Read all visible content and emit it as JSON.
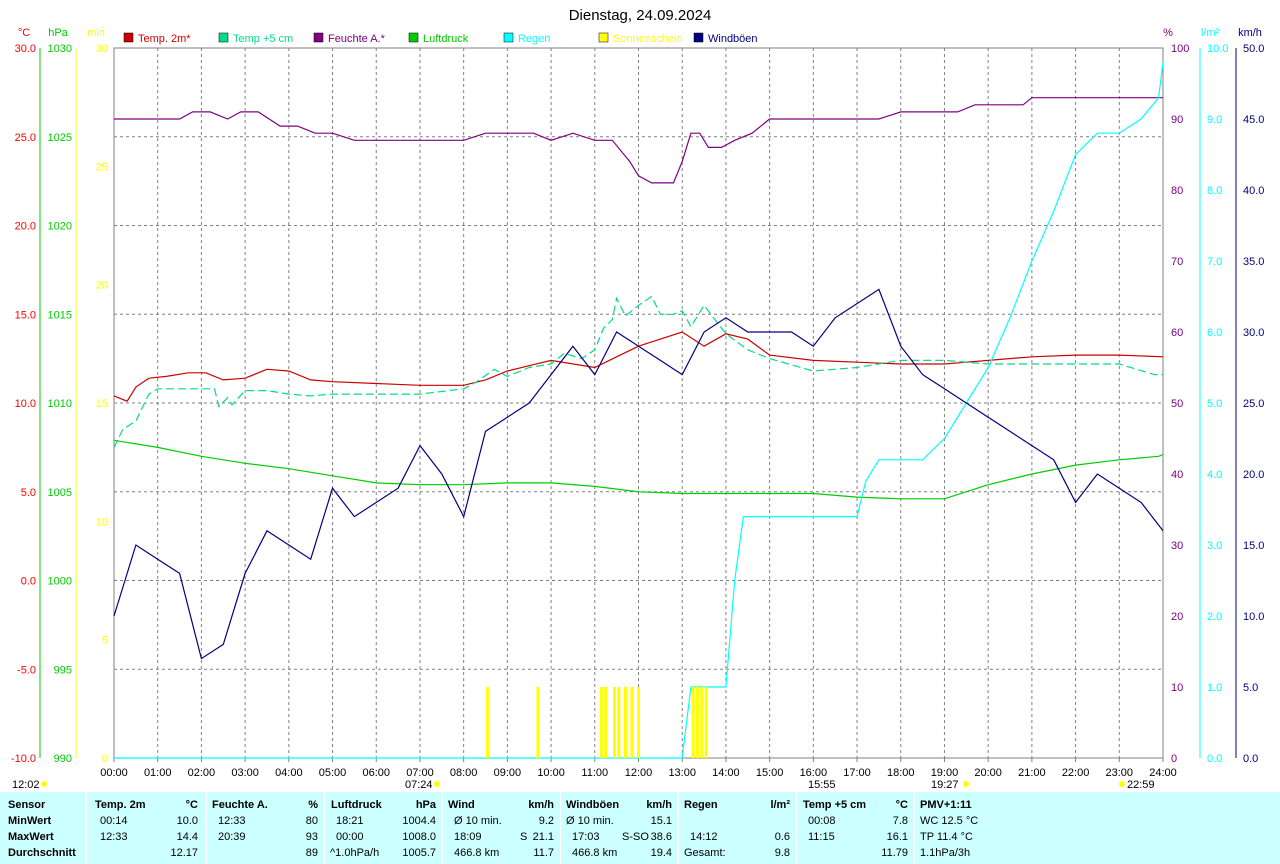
{
  "title": "Dienstag, 24.09.2024",
  "chart_data": {
    "type": "line",
    "x_label_times": [
      "00:00",
      "01:00",
      "02:00",
      "03:00",
      "04:00",
      "05:00",
      "06:00",
      "07:00",
      "08:00",
      "09:00",
      "10:00",
      "11:00",
      "12:00",
      "13:00",
      "14:00",
      "15:00",
      "16:00",
      "17:00",
      "18:00",
      "19:00",
      "20:00",
      "21:00",
      "22:00",
      "23:00",
      "24:00"
    ],
    "x_range_hours": [
      0,
      24
    ],
    "axes": {
      "temp_c": {
        "unit": "°C",
        "range": [
          -10,
          30
        ],
        "ticks": [
          "30.0",
          "25.0",
          "20.0",
          "15.0",
          "10.0",
          "5.0",
          "0.0",
          "-5.0",
          "-10.0"
        ],
        "color": "#ff0000"
      },
      "press_hpa": {
        "unit": "hPa",
        "range": [
          990,
          1030
        ],
        "ticks": [
          "1030",
          "1025",
          "1020",
          "1015",
          "1010",
          "1005",
          "1000",
          "995",
          "990"
        ],
        "color": "#00cc00"
      },
      "sun_min": {
        "unit": "min",
        "range": [
          0,
          30
        ],
        "ticks": [
          "30",
          "25",
          "20",
          "15",
          "10",
          "5",
          "0"
        ],
        "color": "#ffff00"
      },
      "hum_pct": {
        "unit": "%",
        "range": [
          0,
          100
        ],
        "ticks": [
          "100",
          "90",
          "80",
          "70",
          "60",
          "50",
          "40",
          "30",
          "20",
          "10",
          "0"
        ],
        "color": "#800080"
      },
      "rain_lm2": {
        "unit": "l/m²",
        "range": [
          0,
          10
        ],
        "ticks": [
          "10.0",
          "9.0",
          "8.0",
          "7.0",
          "6.0",
          "5.0",
          "4.0",
          "3.0",
          "2.0",
          "1.0",
          "0.0"
        ],
        "color": "#00ffff"
      },
      "wind_kmh": {
        "unit": "km/h",
        "range": [
          0,
          50
        ],
        "ticks": [
          "50.0",
          "45.0",
          "40.0",
          "35.0",
          "30.0",
          "25.0",
          "20.0",
          "15.0",
          "10.0",
          "5.0",
          "0.0"
        ],
        "color": "#000080"
      }
    },
    "grid": true,
    "legend_position": "top",
    "series": [
      {
        "name": "Temp. 2m*",
        "color": "#cc0000",
        "axis": "temp_c",
        "x": [
          0,
          0.3,
          0.5,
          0.8,
          1.2,
          1.7,
          2.1,
          2.5,
          3.0,
          3.5,
          4.0,
          4.5,
          5.0,
          6.0,
          7.0,
          8.0,
          8.5,
          9.0,
          9.5,
          10.0,
          11.0,
          11.5,
          12.0,
          12.5,
          13.0,
          13.5,
          14.0,
          14.5,
          15.0,
          16.0,
          17.0,
          18.0,
          19.0,
          19.5,
          20.0,
          21.0,
          22.0,
          23.0,
          24.0
        ],
        "y": [
          10.4,
          10.1,
          10.9,
          11.4,
          11.5,
          11.7,
          11.7,
          11.3,
          11.4,
          11.9,
          11.8,
          11.3,
          11.2,
          11.1,
          11.0,
          11.0,
          11.3,
          11.8,
          12.1,
          12.4,
          12.0,
          12.6,
          13.2,
          13.6,
          14.0,
          13.2,
          13.9,
          13.6,
          12.7,
          12.4,
          12.3,
          12.2,
          12.2,
          12.3,
          12.4,
          12.6,
          12.7,
          12.7,
          12.6
        ]
      },
      {
        "name": "Temp +5 cm",
        "color": "#00dd88",
        "axis": "temp_c",
        "dashed": true,
        "x": [
          0,
          0.2,
          0.5,
          0.8,
          1.0,
          2.3,
          2.4,
          2.6,
          2.7,
          3.0,
          3.5,
          4.0,
          4.5,
          5.0,
          6.0,
          7.0,
          8.0,
          8.3,
          8.7,
          9.0,
          9.5,
          10.0,
          10.3,
          10.7,
          11.0,
          11.2,
          11.4,
          11.5,
          11.7,
          12.0,
          12.3,
          12.5,
          12.8,
          13.0,
          13.2,
          13.5,
          14.0,
          14.5,
          15.0,
          16.0,
          17.0,
          18.0,
          19.0,
          20.0,
          21.0,
          22.0,
          23.0,
          23.8,
          24.0
        ],
        "y": [
          7.5,
          8.5,
          9.0,
          10.5,
          10.8,
          10.8,
          9.8,
          10.3,
          9.9,
          10.7,
          10.7,
          10.5,
          10.4,
          10.5,
          10.5,
          10.5,
          10.8,
          11.2,
          11.9,
          11.5,
          12.0,
          12.2,
          12.8,
          12.5,
          13.0,
          14.2,
          14.7,
          15.9,
          14.9,
          15.5,
          16.0,
          15.0,
          15.0,
          15.2,
          14.3,
          15.5,
          13.9,
          13.0,
          12.5,
          11.8,
          12.0,
          12.4,
          12.4,
          12.2,
          12.2,
          12.2,
          12.2,
          11.6,
          11.6
        ]
      },
      {
        "name": "Feuchte A.*",
        "color": "#800080",
        "axis": "hum_pct",
        "x": [
          0,
          0.5,
          1.0,
          1.5,
          1.8,
          2.2,
          2.6,
          2.9,
          3.3,
          3.8,
          4.2,
          4.6,
          5.0,
          5.5,
          6.0,
          7.0,
          8.0,
          8.5,
          9.0,
          9.6,
          10.0,
          10.5,
          11.0,
          11.4,
          11.8,
          12.0,
          12.3,
          12.6,
          12.8,
          13.0,
          13.2,
          13.4,
          13.6,
          13.9,
          14.2,
          14.6,
          15.0,
          16.0,
          17.0,
          17.5,
          18.0,
          18.5,
          19.0,
          19.3,
          19.7,
          20.0,
          20.4,
          20.8,
          21.0,
          21.5,
          22.0,
          22.5,
          23.0,
          23.5,
          24.0
        ],
        "y": [
          90,
          90,
          90,
          90,
          91,
          91,
          90,
          91,
          91,
          89,
          89,
          88,
          88,
          87,
          87,
          87,
          87,
          88,
          88,
          88,
          87,
          88,
          87,
          87,
          84,
          82,
          81,
          81,
          81,
          84,
          88,
          88,
          86,
          86,
          87,
          88,
          90,
          90,
          90,
          90,
          91,
          91,
          91,
          91,
          92,
          92,
          92,
          92,
          93,
          93,
          93,
          93,
          93,
          93,
          93
        ]
      },
      {
        "name": "Luftdruck",
        "color": "#00cc00",
        "axis": "press_hpa",
        "x": [
          0,
          1,
          2,
          3,
          4,
          5,
          6,
          7,
          8,
          9,
          10,
          11,
          12,
          13,
          14,
          15,
          16,
          17,
          18,
          19,
          20,
          21,
          22,
          23,
          23.9,
          24
        ],
        "y": [
          1007.9,
          1007.5,
          1007.0,
          1006.6,
          1006.3,
          1005.9,
          1005.5,
          1005.4,
          1005.4,
          1005.5,
          1005.5,
          1005.3,
          1005.0,
          1004.9,
          1004.9,
          1004.9,
          1004.9,
          1004.7,
          1004.6,
          1004.6,
          1005.4,
          1006.0,
          1006.5,
          1006.8,
          1007.0,
          1007.1
        ]
      },
      {
        "name": "Regen",
        "color": "#00ffff",
        "axis": "rain_lm2",
        "x": [
          0,
          13.0,
          13.2,
          13.4,
          14.0,
          14.2,
          14.4,
          14.6,
          16.0,
          16.5,
          17.0,
          17.2,
          17.5,
          17.8,
          18.0,
          18.5,
          19.0,
          19.5,
          20.0,
          20.5,
          21.0,
          21.5,
          22.0,
          22.5,
          23.0,
          23.5,
          23.9,
          24
        ],
        "y": [
          0,
          0,
          1.0,
          1.0,
          1.0,
          2.5,
          3.4,
          3.4,
          3.4,
          3.4,
          3.4,
          3.9,
          4.2,
          4.2,
          4.2,
          4.2,
          4.5,
          5.0,
          5.5,
          6.2,
          7.0,
          7.7,
          8.5,
          8.8,
          8.8,
          9.0,
          9.3,
          9.8
        ]
      },
      {
        "name": "Sonnenschein",
        "color": "#ffff00",
        "axis": "sun_min",
        "x": [
          8.55,
          9.7,
          11.15,
          11.25,
          11.45,
          11.55,
          11.7,
          11.85,
          12.0,
          13.25,
          13.35,
          13.45,
          13.55
        ],
        "y": [
          3,
          3,
          3,
          3,
          3,
          3,
          3,
          3,
          3,
          3,
          3,
          3,
          3
        ]
      },
      {
        "name": "Windböen",
        "color": "#000080",
        "axis": "wind_kmh",
        "x": [
          0,
          0.5,
          1.0,
          1.5,
          2.0,
          2.5,
          3.0,
          3.5,
          4.0,
          4.5,
          5.0,
          5.5,
          6.0,
          6.5,
          7.0,
          7.5,
          8.0,
          8.5,
          9.0,
          9.5,
          10.0,
          10.5,
          11.0,
          11.5,
          12.0,
          12.5,
          13.0,
          13.5,
          14.0,
          14.5,
          15.0,
          15.5,
          16.0,
          16.5,
          17.0,
          17.5,
          18.0,
          18.5,
          19.0,
          19.5,
          20.0,
          20.5,
          21.0,
          21.5,
          22.0,
          22.5,
          23.0,
          23.5,
          24.0
        ],
        "y": [
          10,
          15,
          14,
          13,
          7,
          8,
          13,
          16,
          15,
          14,
          19,
          17,
          18,
          19,
          22,
          20,
          17,
          23,
          24,
          25,
          27,
          29,
          27,
          30,
          29,
          28,
          27,
          30,
          31,
          30,
          30,
          30,
          29,
          31,
          32,
          33,
          29,
          27,
          26,
          25,
          24,
          23,
          22,
          21,
          18,
          20,
          19,
          18,
          16
        ]
      }
    ],
    "marker_labels": {
      "sunrise_time": "07:24",
      "transit_time": "15:55",
      "sunset_time": "19:27",
      "moon_left": "12:02",
      "moon_right": "22:59"
    }
  },
  "stats": {
    "sensor": {
      "header": "Sensor",
      "min": "MinWert",
      "max": "MaxWert",
      "avg": "Durchschnitt"
    },
    "temp2m": {
      "header": "Temp. 2m",
      "unit": "°C",
      "min_time": "00:14",
      "min": "10.0",
      "max_time": "12:33",
      "max": "14.4",
      "avg": "12.17"
    },
    "humidity": {
      "header": "Feuchte A.",
      "unit": "%",
      "min_time": "12:33",
      "min": "80",
      "max_time": "20:39",
      "max": "93",
      "avg": "89"
    },
    "pressure": {
      "header": "Luftdruck",
      "unit": "hPa",
      "min_time": "18:21",
      "min": "1004.4",
      "max_time": "00:00",
      "max": "1008.0",
      "avg_label": "^1.0hPa/h",
      "avg": "1005.7"
    },
    "wind": {
      "header": "Wind",
      "unit": "km/h",
      "min_label": "Ø 10 min.",
      "min": "9.2",
      "max_time": "18:09",
      "max_dir": "S",
      "max": "21.1",
      "avg_label": "466.8 km",
      "avg": "11.7"
    },
    "gusts": {
      "header": "Windböen",
      "unit": "km/h",
      "min_label": "Ø 10 min.",
      "min": "15.1",
      "max_time": "17:03",
      "max_dir": "S-SO",
      "max": "38.6",
      "avg_label": "466.8 km",
      "avg": "19.4"
    },
    "rain": {
      "header": "Regen",
      "unit": "l/m²",
      "max_time": "14:12",
      "max": "0.6",
      "avg_label": "Gesamt:",
      "avg": "9.8"
    },
    "temp5cm": {
      "header": "Temp +5 cm",
      "unit": "°C",
      "min_time": "00:08",
      "min": "7.8",
      "max_time": "11:15",
      "max": "16.1",
      "avg": "11.79"
    },
    "pmv": {
      "header": "PMV+1:11",
      "line1": "WC 12.5 °C",
      "line2": "TP 11.4 °C",
      "line3": "1.1hPa/3h"
    }
  }
}
